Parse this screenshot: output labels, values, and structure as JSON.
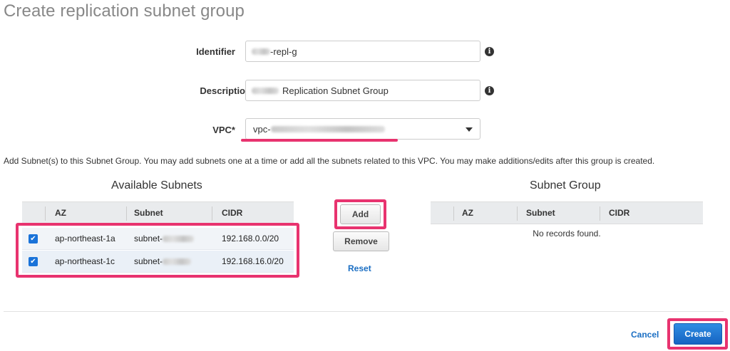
{
  "page": {
    "title": "Create replication subnet group"
  },
  "form": {
    "identifier": {
      "label": "Identifier",
      "value": "-repl-g"
    },
    "description": {
      "label": "Description*",
      "value": "Replication Subnet Group"
    },
    "vpc": {
      "label": "VPC*",
      "value": "vpc-"
    }
  },
  "help_text": "Add Subnet(s) to this Subnet Group. You may add subnets one at a time or add all the subnets related to this VPC. You may make additions/edits after this group is created.",
  "available": {
    "title": "Available Subnets",
    "columns": [
      "AZ",
      "Subnet",
      "CIDR"
    ],
    "rows": [
      {
        "checked": true,
        "az": "ap-northeast-1a",
        "subnet": "subnet-",
        "cidr": "192.168.0.0/20"
      },
      {
        "checked": true,
        "az": "ap-northeast-1c",
        "subnet": "subnet-",
        "cidr": "192.168.16.0/20"
      }
    ]
  },
  "actions": {
    "add": "Add",
    "remove": "Remove",
    "reset": "Reset"
  },
  "group": {
    "title": "Subnet Group",
    "columns": [
      "AZ",
      "Subnet",
      "CIDR"
    ],
    "empty": "No records found."
  },
  "footer": {
    "cancel": "Cancel",
    "create": "Create"
  },
  "colors": {
    "highlight": "#e8336f",
    "primary": "#1a6ec3"
  },
  "icons": {
    "info": "info-icon",
    "dropdown": "caret-down-icon",
    "checkbox": "checkmark-icon"
  }
}
